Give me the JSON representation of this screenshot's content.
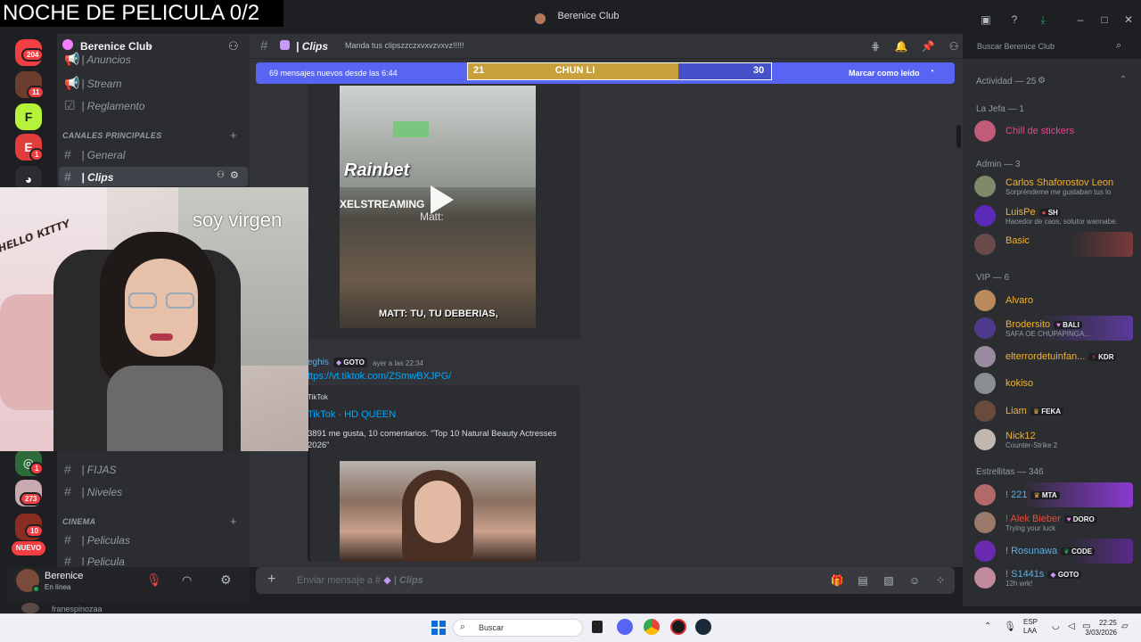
{
  "stream_overlay": {
    "title": "NOCHE DE PELICULA 0/2",
    "webcam_caption": "soy virgen"
  },
  "window": {
    "title": "Berenice Club"
  },
  "rail": {
    "badges": [
      "204",
      "11",
      "1",
      "1",
      "273",
      "10"
    ],
    "new_label": "NUEVO"
  },
  "server": {
    "name": "Berenice Club"
  },
  "sidebar": {
    "channels_top": [
      "| Anuncios",
      "| Stream",
      "| Reglamento"
    ],
    "category_main": "CANALES PRINCIPALES",
    "channels_main": [
      "| General",
      "| Clips"
    ],
    "channels_mid": [
      "| FIJAS",
      "| Niveles"
    ],
    "category_cinema": "CINEMA",
    "channels_cinema": [
      "| Peliculas",
      "| Pelicula"
    ]
  },
  "user": {
    "name": "Berenice",
    "status": "En línea",
    "below_name": "franespinozaa"
  },
  "header": {
    "channel": "| Clips",
    "topic": "Manda tus clipszzczxvxvzvxvz!!!!!",
    "search_placeholder": "Buscar Berenice Club"
  },
  "newbar": {
    "text": "69 mensajes nuevos desde las 6:44",
    "mark_read": "Marcar como leído"
  },
  "scoreboard": {
    "left_score": "21",
    "name": "CHUN LI",
    "right_score": "30"
  },
  "video1": {
    "watermark": "Rainbet",
    "banner": "XELSTREAMING",
    "speaker": "Matt:",
    "subtitle": "MATT: TU, TU DEBERIAS,"
  },
  "message2": {
    "author": "eghis",
    "tag": "GOTO",
    "time": "ayer a las 22:34",
    "link": "ttps://vt.tiktok.com/ZSmwBXJPG/",
    "embed_provider": "TikTok",
    "embed_title": "TikTok · HD QUEEN",
    "embed_desc": "3891 me gusta, 10 comentarios. \"Top 10 Natural Beauty Actresses 2026\""
  },
  "input": {
    "placeholder_prefix": "Enviar mensaje a #",
    "placeholder_channel": "| Clips"
  },
  "members": {
    "activity": "Actividad — 25",
    "groups": [
      {
        "title": "La Jefa — 1",
        "rows": [
          {
            "name": "Chill de stickers",
            "sub": "",
            "tag": "",
            "color": "#f23f8f"
          }
        ]
      },
      {
        "title": "Admin — 3",
        "rows": [
          {
            "name": "Carlos Shaforostov Leon",
            "sub": "Sorpréndeme me gustaban tus lo",
            "tag": "",
            "color": "#f0b232"
          },
          {
            "name": "LuisPe",
            "sub": "Hacedor de caos, solutor wannabe.",
            "tag": "SH",
            "color": "#f0b232"
          },
          {
            "name": "Basic",
            "sub": "",
            "tag": "",
            "color": "#f0b232"
          }
        ]
      },
      {
        "title": "VIP — 6",
        "rows": [
          {
            "name": "Alvaro",
            "sub": "",
            "tag": "",
            "color": "#f0b232"
          },
          {
            "name": "Brodersito",
            "sub": "SAFA OE CHUPAPINGA...",
            "tag": "BALI",
            "color": "#f0b232"
          },
          {
            "name": "elterrordetuinfan...",
            "sub": "",
            "tag": "KDR",
            "color": "#f0b232"
          },
          {
            "name": "kokiso",
            "sub": "",
            "tag": "",
            "color": "#f0b232"
          },
          {
            "name": "Liam",
            "sub": "",
            "tag": "FEKA",
            "color": "#f0b232"
          },
          {
            "name": "Nick12",
            "sub": "Counter-Strike 2",
            "tag": "",
            "color": "#f0b232"
          }
        ]
      },
      {
        "title": "Estrellitas — 346",
        "rows": [
          {
            "name": "! 221",
            "sub": "",
            "tag": "MTA",
            "color": "#5dade2"
          },
          {
            "name": "! Alek Bieber",
            "sub": "Trying your luck",
            "tag": "DORO",
            "color": "#e74c3c"
          },
          {
            "name": "! Rosunawa",
            "sub": "",
            "tag": "CODE",
            "color": "#5dade2"
          },
          {
            "name": "! S1441s",
            "sub": "12h wrk!",
            "tag": "GOTO",
            "color": "#5dade2"
          }
        ]
      }
    ]
  },
  "taskbar": {
    "search": "Buscar",
    "lang1": "ESP",
    "lang2": "LAA",
    "time": "22:25",
    "date": "3/03/2026"
  },
  "colors": {
    "blurple": "#5865f2",
    "score_gold": "#c9a13c",
    "score_blue": "#4451c9"
  }
}
